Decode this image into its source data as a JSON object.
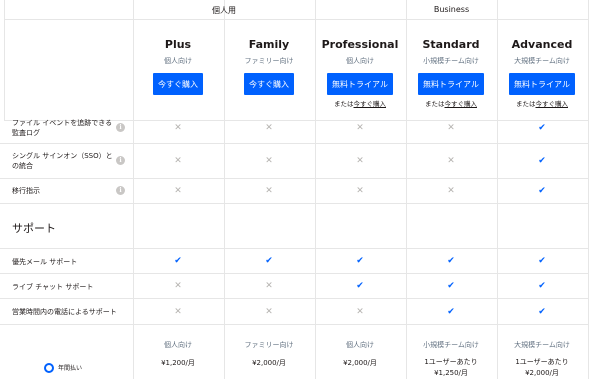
{
  "groups": {
    "personal": "個人用",
    "business": "Business"
  },
  "plans": [
    {
      "name": "Plus",
      "audience": "個人向け",
      "button": "今すぐ購入",
      "or_text": "",
      "or_link": "",
      "price_audience": "個人向け",
      "price_line1": "¥1,200/月",
      "price_line2": ""
    },
    {
      "name": "Family",
      "audience": "ファミリー向け",
      "button": "今すぐ購入",
      "or_text": "",
      "or_link": "",
      "price_audience": "ファミリー向け",
      "price_line1": "¥2,000/月",
      "price_line2": ""
    },
    {
      "name": "Professional",
      "audience": "個人向け",
      "button": "無料トライアル",
      "or_text": "または",
      "or_link": "今すぐ購入",
      "price_audience": "個人向け",
      "price_line1": "¥2,000/月",
      "price_line2": ""
    },
    {
      "name": "Standard",
      "audience": "小規模チーム向け",
      "button": "無料トライアル",
      "or_text": "または",
      "or_link": "今すぐ購入",
      "price_audience": "小規模チーム向け",
      "price_line1": "1ユーザーあたり",
      "price_line2": "¥1,250/月"
    },
    {
      "name": "Advanced",
      "audience": "大規模チーム向け",
      "button": "無料トライアル",
      "or_text": "または",
      "or_link": "今すぐ購入",
      "price_audience": "大規模チーム向け",
      "price_line1": "1ユーザーあたり",
      "price_line2": "¥2,000/月"
    }
  ],
  "features_top": [
    {
      "label_line1": "ファイル イベントを追跡できる",
      "label_line2": "監査ログ",
      "values": [
        "x",
        "x",
        "x",
        "x",
        "check"
      ]
    },
    {
      "label_line1": "シングル サインオン（SSO）と",
      "label_line2": "の統合",
      "values": [
        "x",
        "x",
        "x",
        "x",
        "check"
      ]
    },
    {
      "label_line1": "移行指示",
      "label_line2": "",
      "values": [
        "x",
        "x",
        "x",
        "x",
        "check"
      ]
    }
  ],
  "support_section": "サポート",
  "features_support": [
    {
      "label": "優先メール サポート",
      "values": [
        "check",
        "check",
        "check",
        "check",
        "check"
      ]
    },
    {
      "label": "ライブ チャット サポート",
      "values": [
        "x",
        "x",
        "check",
        "check",
        "check"
      ]
    },
    {
      "label": "営業時間内の電話によるサポート",
      "values": [
        "x",
        "x",
        "x",
        "check",
        "check"
      ]
    }
  ],
  "billing": {
    "annual_label": "年間払い"
  },
  "glyphs": {
    "check": "✔",
    "x": "✕",
    "info": "i"
  },
  "colors": {
    "accent": "#0061fe",
    "muted": "#637282",
    "border": "#e6e6e6"
  }
}
